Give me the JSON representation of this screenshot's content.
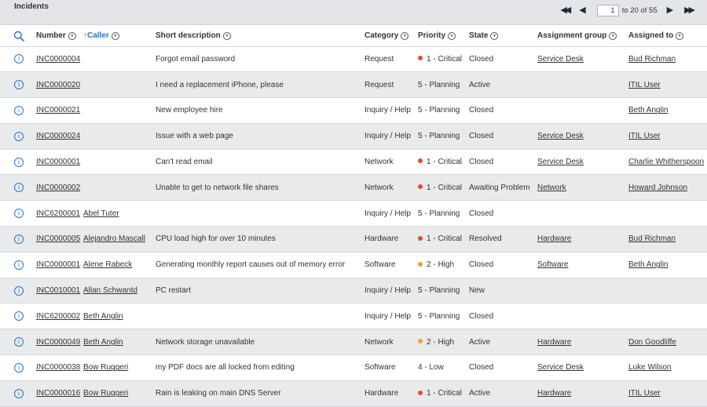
{
  "header": {
    "title": "Incidents",
    "page_value": "1",
    "page_text": "to 20 of 55"
  },
  "columns": {
    "number": "Number",
    "caller": "Caller",
    "short_description": "Short description",
    "category": "Category",
    "priority": "Priority",
    "state": "State",
    "assignment_group": "Assignment group",
    "assigned_to": "Assigned to"
  },
  "icons": {
    "search": "search-icon",
    "info": "info-icon",
    "column_menu": "chevron-down-icon",
    "sort": "arrow-up-icon"
  },
  "colors": {
    "accent": "#2b73c9",
    "critical": "#e8482f",
    "high": "#f1a22b"
  },
  "rows": [
    {
      "number": "INC0000004",
      "caller": "",
      "short_description": "Forgot email password",
      "category": "Request",
      "priority": "1 - Critical",
      "priority_level": "critical",
      "state": "Closed",
      "assignment_group": "Service Desk",
      "assigned_to": "Bud Richman"
    },
    {
      "number": "INC0000020",
      "caller": "",
      "short_description": "I need a replacement iPhone, please",
      "category": "Request",
      "priority": "5 - Planning",
      "priority_level": "",
      "state": "Active",
      "assignment_group": "",
      "assigned_to": "ITIL User"
    },
    {
      "number": "INC0000021",
      "caller": "",
      "short_description": "New employee hire",
      "category": "Inquiry / Help",
      "priority": "5 - Planning",
      "priority_level": "",
      "state": "Closed",
      "assignment_group": "",
      "assigned_to": "Beth Anglin"
    },
    {
      "number": "INC0000024",
      "caller": "",
      "short_description": "Issue with a web page",
      "category": "Inquiry / Help",
      "priority": "5 - Planning",
      "priority_level": "",
      "state": "Closed",
      "assignment_group": "Service Desk",
      "assigned_to": "ITIL User"
    },
    {
      "number": "INC0000001",
      "caller": "",
      "short_description": "Can't read email",
      "category": "Network",
      "priority": "1 - Critical",
      "priority_level": "critical",
      "state": "Closed",
      "assignment_group": "Service Desk",
      "assigned_to": "Charlie Whitherspoon"
    },
    {
      "number": "INC0000002",
      "caller": "",
      "short_description": "Unable to get to network file shares",
      "category": "Network",
      "priority": "1 - Critical",
      "priority_level": "critical",
      "state": "Awaiting Problem",
      "assignment_group": "Network",
      "assigned_to": "Howard Johnson"
    },
    {
      "number": "INC6200001",
      "caller": "Abel Tuter",
      "short_description": "",
      "category": "Inquiry / Help",
      "priority": "5 - Planning",
      "priority_level": "",
      "state": "Closed",
      "assignment_group": "",
      "assigned_to": ""
    },
    {
      "number": "INC0000005",
      "caller": "Alejandro Mascall",
      "short_description": "CPU load high for over 10 minutes",
      "category": "Hardware",
      "priority": "1 - Critical",
      "priority_level": "critical",
      "state": "Resolved",
      "assignment_group": "Hardware",
      "assigned_to": "Bud Richman"
    },
    {
      "number": "INC0000001",
      "caller": "Alene Rabeck",
      "short_description": "Generating monthly report causes out of memory error",
      "category": "Software",
      "priority": "2 - High",
      "priority_level": "high",
      "state": "Closed",
      "assignment_group": "Software",
      "assigned_to": "Beth Anglin"
    },
    {
      "number": "INC0010001",
      "caller": "Allan Schwantd",
      "short_description": "PC restart",
      "category": "Inquiry / Help",
      "priority": "5 - Planning",
      "priority_level": "",
      "state": "New",
      "assignment_group": "",
      "assigned_to": ""
    },
    {
      "number": "INC6200002",
      "caller": "Beth Anglin",
      "short_description": "",
      "category": "Inquiry / Help",
      "priority": "5 - Planning",
      "priority_level": "",
      "state": "Closed",
      "assignment_group": "",
      "assigned_to": ""
    },
    {
      "number": "INC0000049",
      "caller": "Beth Anglin",
      "short_description": "Network storage unavailable",
      "category": "Network",
      "priority": "2 - High",
      "priority_level": "high",
      "state": "Active",
      "assignment_group": "Hardware",
      "assigned_to": "Don Goodliffe"
    },
    {
      "number": "INC0000038",
      "caller": "Bow Ruggeri",
      "short_description": "my PDF docs are all locked from editing",
      "category": "Software",
      "priority": "4 - Low",
      "priority_level": "",
      "state": "Closed",
      "assignment_group": "Service Desk",
      "assigned_to": "Luke Wilson"
    },
    {
      "number": "INC0000016",
      "caller": "Bow Ruggeri",
      "short_description": "Rain is leaking on main DNS Server",
      "category": "Hardware",
      "priority": "1 - Critical",
      "priority_level": "critical",
      "state": "Active",
      "assignment_group": "Hardware",
      "assigned_to": "ITIL User"
    }
  ]
}
